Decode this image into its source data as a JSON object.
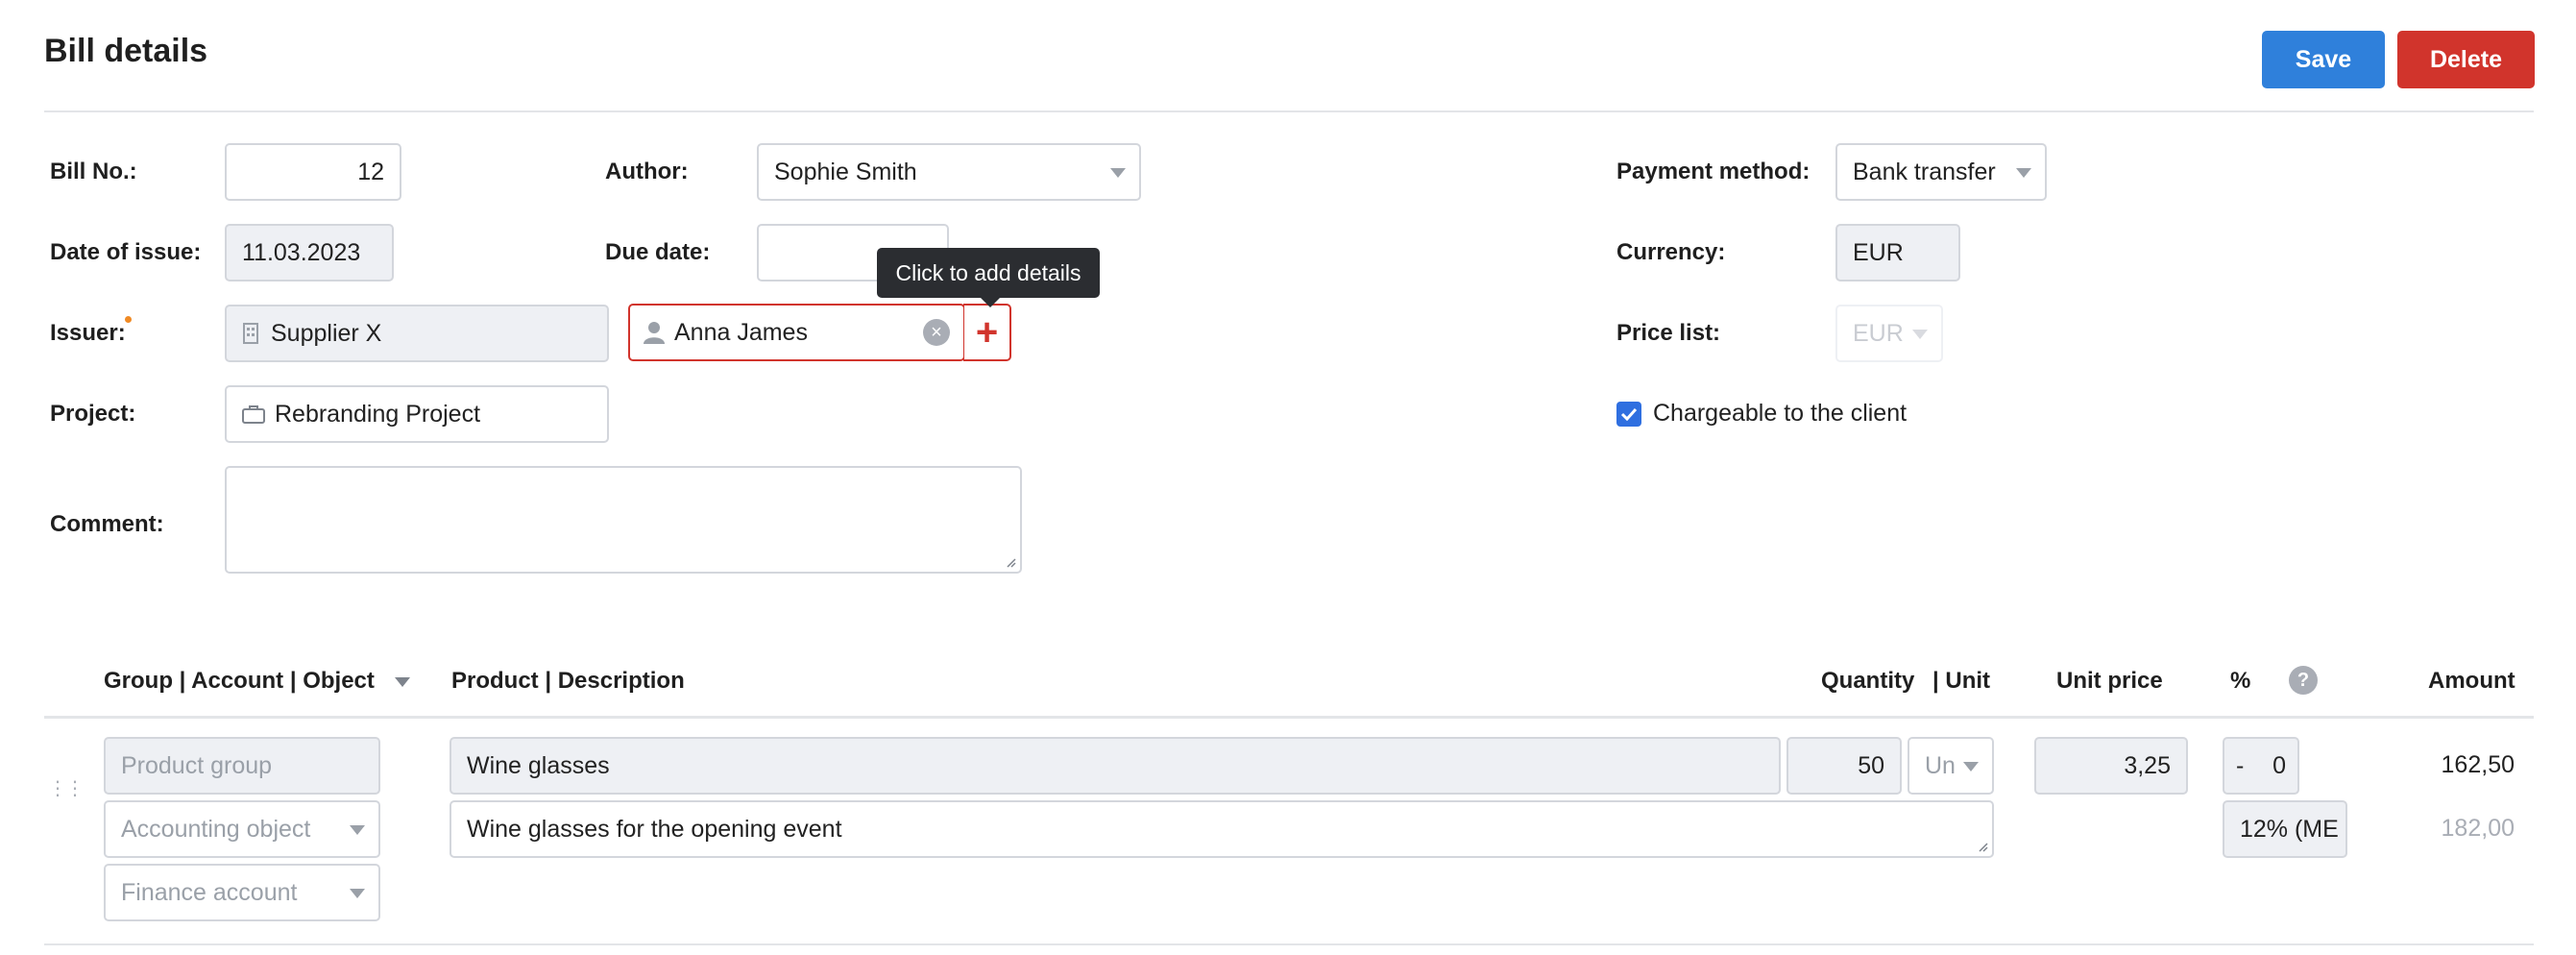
{
  "header": {
    "title": "Bill details",
    "save_label": "Save",
    "delete_label": "Delete"
  },
  "form": {
    "bill_no_label": "Bill No.:",
    "bill_no_value": "12",
    "date_of_issue_label": "Date of issue:",
    "date_of_issue_value": "11.03.2023",
    "issuer_label": "Issuer:",
    "issuer_value": "Supplier X",
    "contact_value": "Anna James",
    "project_label": "Project:",
    "project_value": "Rebranding Project",
    "comment_label": "Comment:",
    "comment_value": "",
    "author_label": "Author:",
    "author_value": "Sophie Smith",
    "due_date_label": "Due date:",
    "due_date_value": "",
    "payment_method_label": "Payment method:",
    "payment_method_value": "Bank transfer",
    "currency_label": "Currency:",
    "currency_value": "EUR",
    "price_list_label": "Price list:",
    "price_list_value": "EUR",
    "chargeable_label": "Chargeable to the client",
    "chargeable_checked": true
  },
  "tooltip": {
    "text": "Click to add details"
  },
  "table": {
    "headers": {
      "group": "Group | Account | Object",
      "product": "Product | Description",
      "quantity": "Quantity",
      "unit": "| Unit",
      "unit_price": "Unit price",
      "percent": "%",
      "amount": "Amount"
    },
    "rows": [
      {
        "product_group_placeholder": "Product group",
        "accounting_object_placeholder": "Accounting object",
        "finance_account_placeholder": "Finance account",
        "product": "Wine glasses",
        "description": "Wine glasses for the opening event",
        "quantity": "50",
        "unit": "Un",
        "unit_price": "3,25",
        "discount_sign": "-",
        "discount_value": "0",
        "tax": "12% (ME",
        "amount": "162,50",
        "amount_with_tax": "182,00"
      }
    ]
  },
  "colors": {
    "primary": "#2f80db",
    "danger": "#d1342c",
    "field_gray": "#eef0f4",
    "border": "#d3d6dc"
  }
}
